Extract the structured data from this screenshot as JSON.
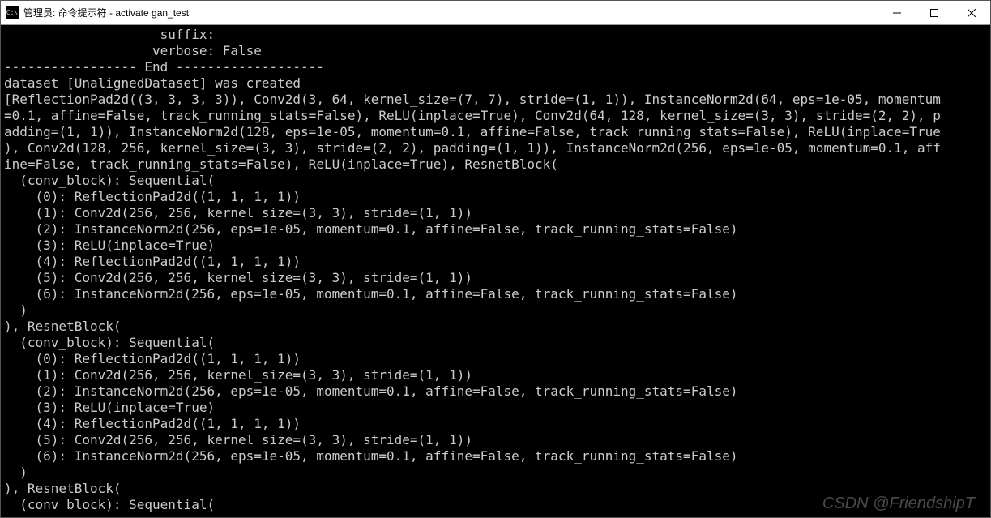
{
  "window": {
    "title": "管理员: 命令提示符 - activate  gan_test"
  },
  "terminal": {
    "lines": [
      "                    suffix:",
      "                   verbose: False",
      "----------------- End -------------------",
      "dataset [UnalignedDataset] was created",
      "[ReflectionPad2d((3, 3, 3, 3)), Conv2d(3, 64, kernel_size=(7, 7), stride=(1, 1)), InstanceNorm2d(64, eps=1e-05, momentum",
      "=0.1, affine=False, track_running_stats=False), ReLU(inplace=True), Conv2d(64, 128, kernel_size=(3, 3), stride=(2, 2), p",
      "adding=(1, 1)), InstanceNorm2d(128, eps=1e-05, momentum=0.1, affine=False, track_running_stats=False), ReLU(inplace=True",
      "), Conv2d(128, 256, kernel_size=(3, 3), stride=(2, 2), padding=(1, 1)), InstanceNorm2d(256, eps=1e-05, momentum=0.1, aff",
      "ine=False, track_running_stats=False), ReLU(inplace=True), ResnetBlock(",
      "  (conv_block): Sequential(",
      "    (0): ReflectionPad2d((1, 1, 1, 1))",
      "    (1): Conv2d(256, 256, kernel_size=(3, 3), stride=(1, 1))",
      "    (2): InstanceNorm2d(256, eps=1e-05, momentum=0.1, affine=False, track_running_stats=False)",
      "    (3): ReLU(inplace=True)",
      "    (4): ReflectionPad2d((1, 1, 1, 1))",
      "    (5): Conv2d(256, 256, kernel_size=(3, 3), stride=(1, 1))",
      "    (6): InstanceNorm2d(256, eps=1e-05, momentum=0.1, affine=False, track_running_stats=False)",
      "  )",
      "), ResnetBlock(",
      "  (conv_block): Sequential(",
      "    (0): ReflectionPad2d((1, 1, 1, 1))",
      "    (1): Conv2d(256, 256, kernel_size=(3, 3), stride=(1, 1))",
      "    (2): InstanceNorm2d(256, eps=1e-05, momentum=0.1, affine=False, track_running_stats=False)",
      "    (3): ReLU(inplace=True)",
      "    (4): ReflectionPad2d((1, 1, 1, 1))",
      "    (5): Conv2d(256, 256, kernel_size=(3, 3), stride=(1, 1))",
      "    (6): InstanceNorm2d(256, eps=1e-05, momentum=0.1, affine=False, track_running_stats=False)",
      "  )",
      "), ResnetBlock(",
      "  (conv_block): Sequential("
    ]
  },
  "watermark": "CSDN @FriendshipT"
}
